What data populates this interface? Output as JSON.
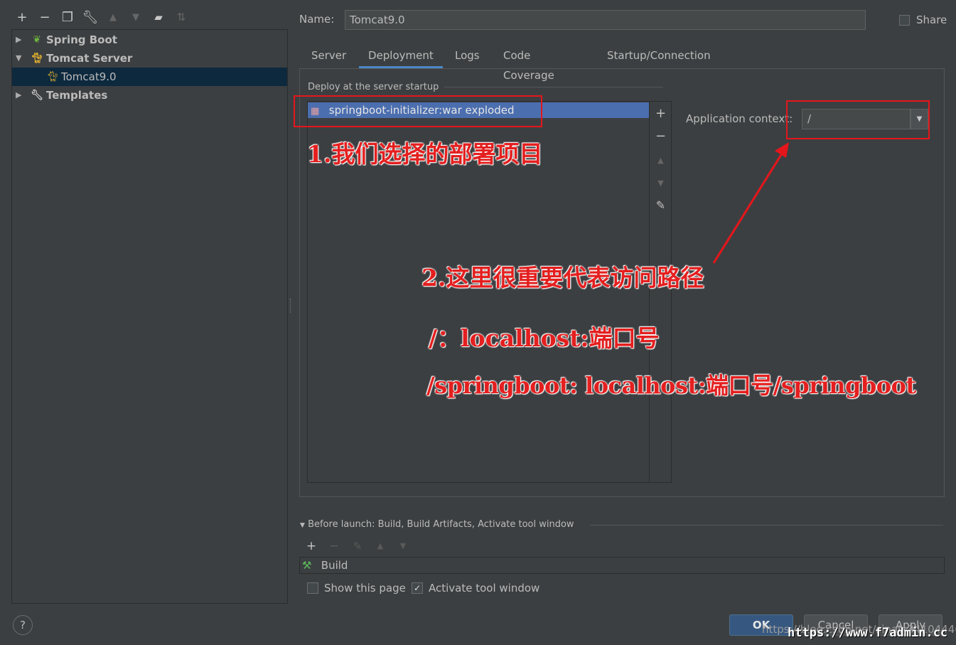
{
  "toolbar": {
    "icons": [
      "add-icon",
      "remove-icon",
      "copy-icon",
      "wrench-icon",
      "move-up-icon",
      "move-down-icon",
      "folder-add-icon",
      "sort-icon"
    ]
  },
  "tree": {
    "items": [
      {
        "label": "Spring Boot",
        "icon": "spring-boot-icon",
        "expanded": false
      },
      {
        "label": "Tomcat Server",
        "icon": "tomcat-icon",
        "expanded": true
      },
      {
        "label": "Tomcat9.0",
        "icon": "tomcat-icon",
        "selected": true
      },
      {
        "label": "Templates",
        "icon": "wrench-icon",
        "expanded": false
      }
    ]
  },
  "form": {
    "name_label": "Name:",
    "name_value": "Tomcat9.0",
    "share_label": "Share",
    "share_checked": false
  },
  "tabs": [
    {
      "label": "Server",
      "active": false
    },
    {
      "label": "Deployment",
      "active": true
    },
    {
      "label": "Logs",
      "active": false
    },
    {
      "label": "Code Coverage",
      "active": false
    },
    {
      "label": "Startup/Connection",
      "active": false
    }
  ],
  "deployment": {
    "section_title": "Deploy at the server startup",
    "artifacts": [
      "springboot-initializer:war exploded"
    ],
    "context_label": "Application context:",
    "context_value": "/"
  },
  "before_launch": {
    "title": "Before launch: Build, Build Artifacts, Activate tool window",
    "tasks": [
      "Build"
    ],
    "show_page_label": "Show this page",
    "show_page_checked": false,
    "activate_label": "Activate tool window",
    "activate_checked": true
  },
  "buttons": {
    "help": "?",
    "ok": "OK",
    "cancel": "Cancel",
    "apply": "Apply"
  },
  "annotations": {
    "note1": "1.我们选择的部署项目",
    "note2": "2.这里很重要代表访问路径",
    "note3": "/：localhost:端口号",
    "note4": "/springboot: localhost:端口号/springboot",
    "color": "#e41f1f"
  },
  "watermark": {
    "url": "https://blog.csdn.net/sinat_34104446",
    "site": "https://www.f7admin.cc"
  }
}
